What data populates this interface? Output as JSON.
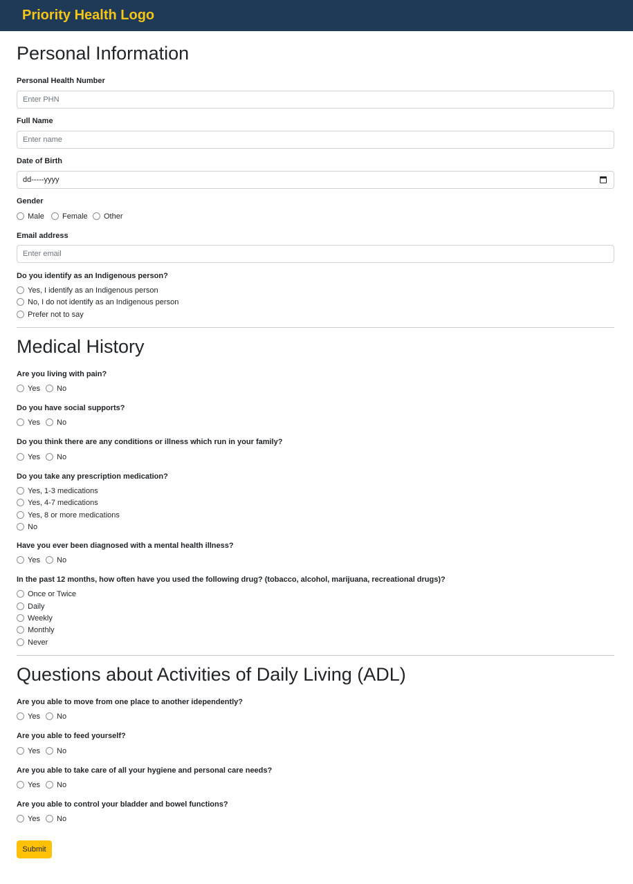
{
  "header": {
    "brand": "Priority Health Logo"
  },
  "personal": {
    "title": "Personal Information",
    "phn_label": "Personal Health Number",
    "phn_placeholder": "Enter PHN",
    "name_label": "Full Name",
    "name_placeholder": "Enter name",
    "dob_label": "Date of Birth",
    "dob_value": "dd-----yyyy",
    "gender_label": "Gender",
    "gender_options": [
      "Male",
      "Female",
      "Other"
    ],
    "email_label": "Email address",
    "email_placeholder": "Enter email",
    "indigenous_label": "Do you identify as an Indigenous person?",
    "indigenous_options": [
      "Yes, I identify as an Indigenous person",
      "No, I do not identify as an Indigenous person",
      "Prefer not to say"
    ]
  },
  "medical": {
    "title": "Medical History",
    "pain": {
      "question": "Are you living with pain?",
      "options": [
        "Yes",
        "No"
      ]
    },
    "supports": {
      "question": "Do you have social supports?",
      "options": [
        "Yes",
        "No"
      ]
    },
    "family": {
      "question": "Do you think there are any conditions or illness which run in your family?",
      "options": [
        "Yes",
        "No"
      ]
    },
    "medication": {
      "question": "Do you take any prescription medication?",
      "options": [
        "Yes, 1-3 medications",
        "Yes, 4-7 medications",
        "Yes, 8 or more medications",
        "No"
      ]
    },
    "mental": {
      "question": "Have you ever been diagnosed with a mental health illness?",
      "options": [
        "Yes",
        "No"
      ]
    },
    "drugs": {
      "question": "In the past 12 months, how often have you used the following drug? (tobacco, alcohol, marijuana, recreational drugs)?",
      "options": [
        "Once or Twice",
        "Daily",
        "Weekly",
        "Monthly",
        "Never"
      ]
    }
  },
  "adl": {
    "title": "Questions about Activities of Daily Living (ADL)",
    "move": {
      "question": "Are you able to move from one place to another idependently?",
      "options": [
        "Yes",
        "No"
      ]
    },
    "feed": {
      "question": "Are you able to feed yourself?",
      "options": [
        "Yes",
        "No"
      ]
    },
    "hygiene": {
      "question": "Are you able to take care of all your hygiene and personal care needs?",
      "options": [
        "Yes",
        "No"
      ]
    },
    "bladder": {
      "question": "Are you able to control your bladder and bowel functions?",
      "options": [
        "Yes",
        "No"
      ]
    }
  },
  "submit_label": "Submit"
}
